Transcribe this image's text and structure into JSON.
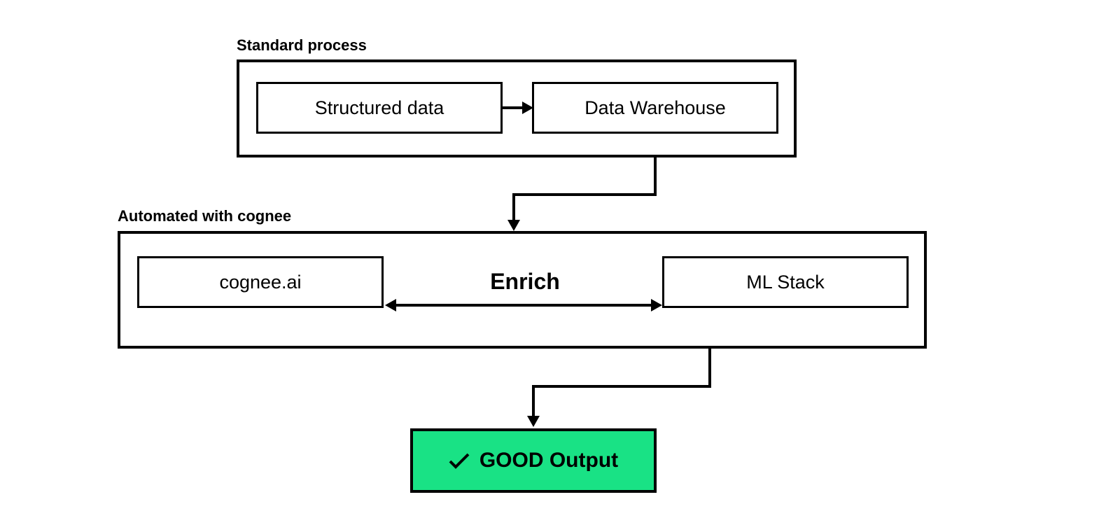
{
  "section1_label": "Standard process",
  "section2_label": "Automated with cognee",
  "box_structured_data": "Structured data",
  "box_data_warehouse": "Data Warehouse",
  "box_cognee": "cognee.ai",
  "box_ml_stack": "ML Stack",
  "enrich_label": "Enrich",
  "output_label": "GOOD Output",
  "colors": {
    "stroke": "#000000",
    "output_bg": "#19e285",
    "bg": "#ffffff"
  }
}
